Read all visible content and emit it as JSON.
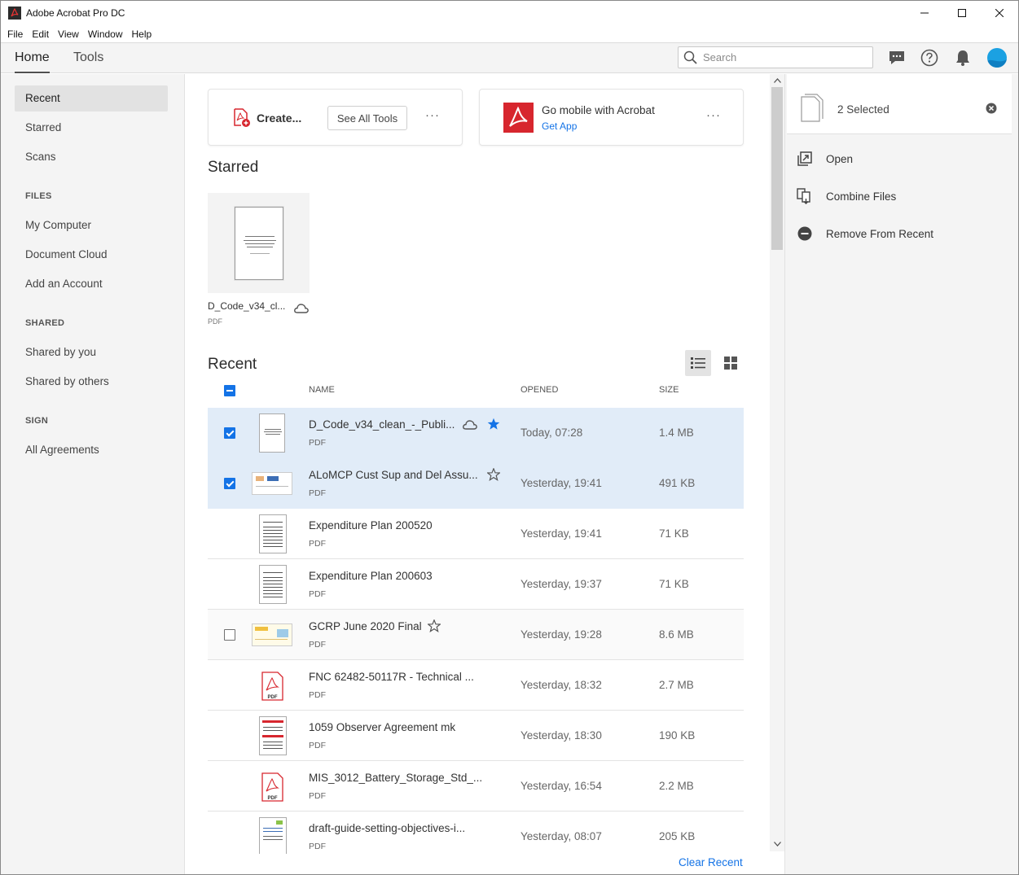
{
  "window": {
    "title": "Adobe Acrobat Pro DC"
  },
  "menu": [
    "File",
    "Edit",
    "View",
    "Window",
    "Help"
  ],
  "nav": {
    "tabs": [
      "Home",
      "Tools"
    ],
    "search_placeholder": "Search"
  },
  "sidebar": {
    "top_items": [
      "Recent",
      "Starred",
      "Scans"
    ],
    "files_heading": "FILES",
    "files_items": [
      "My Computer",
      "Document Cloud",
      "Add an Account"
    ],
    "shared_heading": "SHARED",
    "shared_items": [
      "Shared by you",
      "Shared by others"
    ],
    "sign_heading": "SIGN",
    "sign_items": [
      "All Agreements"
    ]
  },
  "cards": {
    "create_label": "Create...",
    "see_all_tools": "See All Tools",
    "mobile_title": "Go mobile with Acrobat",
    "mobile_link": "Get App",
    "more": "···"
  },
  "starred": {
    "title": "Starred",
    "file_name": "D_Code_v34_cl...",
    "file_type": "PDF"
  },
  "recent": {
    "title": "Recent",
    "col_name": "NAME",
    "col_opened": "OPENED",
    "col_size": "SIZE",
    "clear_label": "Clear Recent",
    "rows": [
      {
        "name": "D_Code_v34_clean_-_Publi...",
        "type": "PDF",
        "opened": "Today, 07:28",
        "size": "1.4 MB"
      },
      {
        "name": "ALoMCP Cust Sup and Del Assu...",
        "type": "PDF",
        "opened": "Yesterday, 19:41",
        "size": "491 KB"
      },
      {
        "name": "Expenditure Plan 200520",
        "type": "PDF",
        "opened": "Yesterday, 19:41",
        "size": "71 KB"
      },
      {
        "name": "Expenditure Plan 200603",
        "type": "PDF",
        "opened": "Yesterday, 19:37",
        "size": "71 KB"
      },
      {
        "name": "GCRP June 2020 Final",
        "type": "PDF",
        "opened": "Yesterday, 19:28",
        "size": "8.6 MB"
      },
      {
        "name": "FNC 62482-50117R - Technical ...",
        "type": "PDF",
        "opened": "Yesterday, 18:32",
        "size": "2.7 MB"
      },
      {
        "name": "1059 Observer Agreement mk",
        "type": "PDF",
        "opened": "Yesterday, 18:30",
        "size": "190 KB"
      },
      {
        "name": "MIS_3012_Battery_Storage_Std_...",
        "type": "PDF",
        "opened": "Yesterday, 16:54",
        "size": "2.2 MB"
      },
      {
        "name": "draft-guide-setting-objectives-i...",
        "type": "PDF",
        "opened": "Yesterday, 08:07",
        "size": "205 KB"
      }
    ]
  },
  "right_panel": {
    "selected_label": "2 Selected",
    "actions": [
      "Open",
      "Combine Files",
      "Remove From Recent"
    ]
  },
  "colors": {
    "accent": "#1473e6",
    "selected_row": "#e1ecf8",
    "acrobat_red": "#d7262e"
  }
}
